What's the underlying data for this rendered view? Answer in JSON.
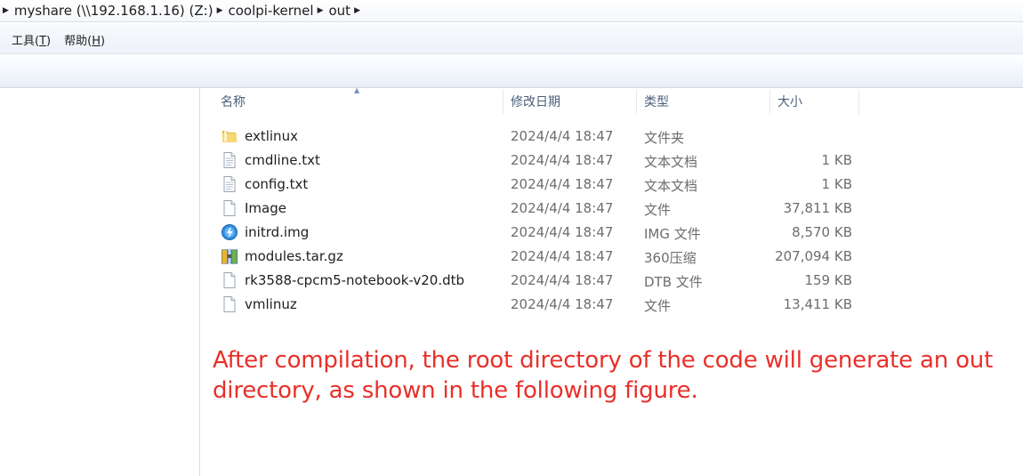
{
  "breadcrumb": {
    "segments": [
      "myshare (\\\\192.168.1.16) (Z:)",
      "coolpi-kernel",
      "out"
    ]
  },
  "menu": {
    "items": [
      {
        "label": "工具(",
        "accel": "T",
        "suffix": ")"
      },
      {
        "label": "帮助(",
        "accel": "H",
        "suffix": ")"
      }
    ]
  },
  "columns": {
    "name": "名称",
    "date": "修改日期",
    "type": "类型",
    "size": "大小",
    "sorted_by": "name"
  },
  "files": [
    {
      "icon": "folder-icon",
      "name": "extlinux",
      "date": "2024/4/4 18:47",
      "type": "文件夹",
      "size": ""
    },
    {
      "icon": "text-file-icon",
      "name": "cmdline.txt",
      "date": "2024/4/4 18:47",
      "type": "文本文档",
      "size": "1 KB"
    },
    {
      "icon": "text-file-icon",
      "name": "config.txt",
      "date": "2024/4/4 18:47",
      "type": "文本文档",
      "size": "1 KB"
    },
    {
      "icon": "blank-file-icon",
      "name": "Image",
      "date": "2024/4/4 18:47",
      "type": "文件",
      "size": "37,811 KB"
    },
    {
      "icon": "disc-image-icon",
      "name": "initrd.img",
      "date": "2024/4/4 18:47",
      "type": "IMG 文件",
      "size": "8,570 KB"
    },
    {
      "icon": "archive-icon",
      "name": "modules.tar.gz",
      "date": "2024/4/4 18:47",
      "type": "360压缩",
      "size": "207,094 KB"
    },
    {
      "icon": "blank-file-icon",
      "name": "rk3588-cpcm5-notebook-v20.dtb",
      "date": "2024/4/4 18:47",
      "type": "DTB 文件",
      "size": "159 KB"
    },
    {
      "icon": "blank-file-icon",
      "name": "vmlinuz",
      "date": "2024/4/4 18:47",
      "type": "文件",
      "size": "13,411 KB"
    }
  ],
  "annotation": {
    "text": "After compilation, the root directory of the code will generate an out directory, as shown in the following figure.",
    "color": "#e8302a"
  },
  "colors": {
    "header_text": "#4c607a",
    "detail_text": "#6d6d6d"
  }
}
